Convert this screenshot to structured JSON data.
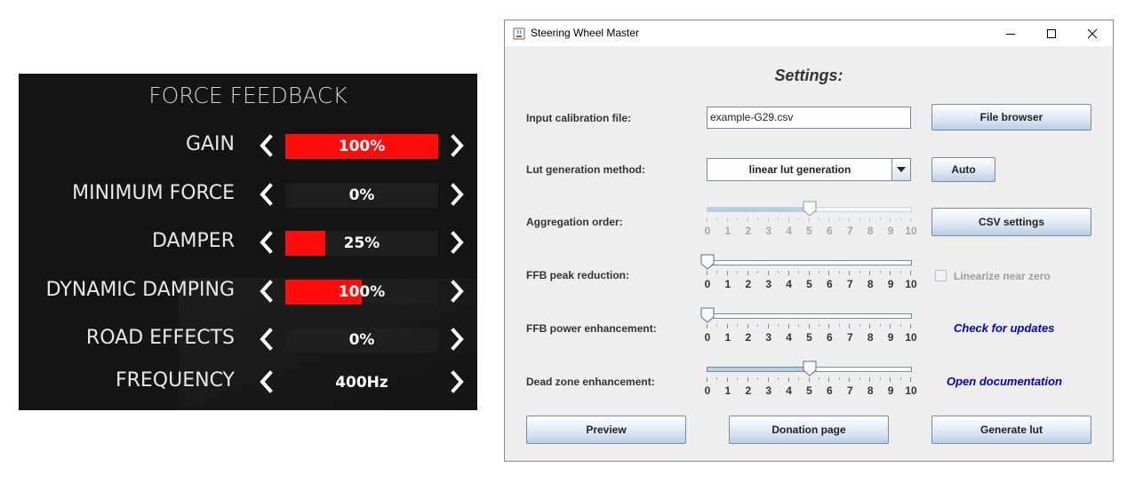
{
  "ffb": {
    "title": "FORCE FEEDBACK",
    "rows": [
      {
        "label": "GAIN",
        "value": "100%",
        "fill": 1.0
      },
      {
        "label": "MINIMUM FORCE",
        "value": "0%",
        "fill": 0.0
      },
      {
        "label": "DAMPER",
        "value": "25%",
        "fill": 0.26
      },
      {
        "label": "DYNAMIC DAMPING",
        "value": "100%",
        "fill": 0.5
      },
      {
        "label": "ROAD EFFECTS",
        "value": "0%",
        "fill": 0.0
      },
      {
        "label": "FREQUENCY",
        "value": "400Hz",
        "fill": null
      }
    ],
    "colors": {
      "bar_fill": "#ff0d0d",
      "background": "#141414"
    }
  },
  "window": {
    "title": "Steering Wheel Master",
    "icons": {
      "app": "java-cup-icon",
      "minimize": "minimize-icon",
      "maximize": "maximize-icon",
      "close": "close-icon"
    },
    "heading": "Settings:",
    "calibration": {
      "label": "Input calibration file:",
      "value": "example-G29.csv",
      "button": "File browser"
    },
    "lut_method": {
      "label": "Lut generation method:",
      "selected": "linear lut generation",
      "button": "Auto"
    },
    "aggregation": {
      "label": "Aggregation order:",
      "value": 5,
      "min": 0,
      "max": 10,
      "enabled": false,
      "button": "CSV settings"
    },
    "peak_reduction": {
      "label": "FFB peak reduction:",
      "value": 0,
      "min": 0,
      "max": 10,
      "enabled": true,
      "checkbox_label": "Linearize near zero",
      "checkbox_checked": false
    },
    "power_enhancement": {
      "label": "FFB power enhancement:",
      "value": 0,
      "min": 0,
      "max": 10,
      "enabled": true,
      "link": "Check for updates"
    },
    "dead_zone": {
      "label": "Dead zone enhancement:",
      "value": 5,
      "min": 0,
      "max": 10,
      "enabled": true,
      "link": "Open documentation"
    },
    "tick_labels": [
      "0",
      "1",
      "2",
      "3",
      "4",
      "5",
      "6",
      "7",
      "8",
      "9",
      "10"
    ],
    "buttons": {
      "preview": "Preview",
      "donation": "Donation page",
      "generate": "Generate lut"
    },
    "colors": {
      "link": "#0000cc",
      "button_top": "#ffffff",
      "button_bottom": "#b8cfe5"
    }
  }
}
